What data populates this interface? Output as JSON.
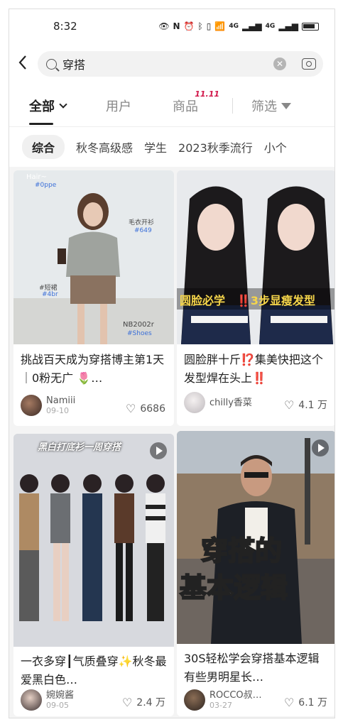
{
  "status": {
    "time": "8:32",
    "signal1": "4G",
    "signal2": "4G"
  },
  "search": {
    "query": "穿搭"
  },
  "tabs": [
    {
      "label": "全部"
    },
    {
      "label": "用户"
    },
    {
      "label": "商品"
    },
    {
      "label": "筛选"
    }
  ],
  "tab_badge": "11.11",
  "chips": [
    "综合",
    "秋冬高级感",
    "学生",
    "2023秋季流行",
    "小个"
  ],
  "cards": [
    {
      "title": "挑战百天成为穿搭博主第1天｜0粉无广 🌷…",
      "author": "Namiii",
      "date": "09-10",
      "likes": "6686",
      "overlay": [
        "Hair~",
        "#0ppe",
        "毛衣开衫",
        "#649",
        "#短裙",
        "#4br",
        "NB2002r",
        "#Shoes"
      ]
    },
    {
      "title": "圆脸胖十斤⁉️集美快把这个发型焊在头上‼️",
      "author": "chilly香菜",
      "date": "",
      "likes": "4.1 万",
      "overlay": [
        "圆脸必学",
        "‼️3步显瘦发型"
      ]
    },
    {
      "title": "一衣多穿┃气质叠穿✨秋冬最爱黑白色…",
      "author": "婉婉酱",
      "date": "09-05",
      "likes": "2.4 万",
      "overlay": [
        "黑白打底衫一周穿搭"
      ]
    },
    {
      "title": "30S轻松学会穿搭基本逻辑 有些男明星长…",
      "author": "ROCCO叔…",
      "date": "03-27",
      "likes": "6.1 万",
      "overlay": [
        "穿搭的",
        "基本逻辑"
      ]
    }
  ],
  "colors": {
    "accent": "#d1174a",
    "background": "#f4f4f4"
  }
}
